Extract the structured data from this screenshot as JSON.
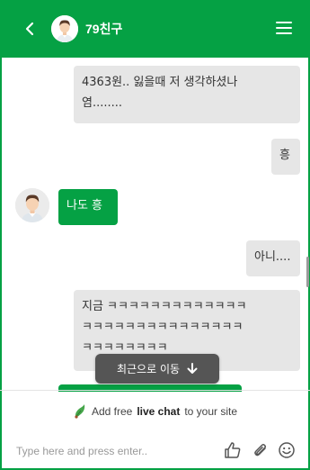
{
  "header": {
    "title": "79친구",
    "back_icon": "chevron-left-icon",
    "menu_icon": "hamburger-menu-icon",
    "color": "#05a144"
  },
  "messages": [
    {
      "side": "out",
      "lines": [
        "4363원.. 잃을때 저 생각하셨나",
        "염........"
      ]
    },
    {
      "side": "out",
      "lines": [
        "흥"
      ]
    },
    {
      "side": "in",
      "lines": [
        "나도 흥"
      ]
    },
    {
      "side": "out",
      "lines": [
        "아니...."
      ]
    },
    {
      "side": "out",
      "lines": [
        "지금 ㅋㅋㅋㅋㅋㅋㅋㅋㅋㅋㅋㅋㅋ",
        "ㅋㅋㅋㅋㅋㅋㅋㅋㅋㅋㅋㅋㅋㅋㅋ",
        "ㅋㅋㅋㅋㅋㅋㅋㅋ"
      ]
    }
  ],
  "jump_button": {
    "label": "최근으로 이동",
    "icon": "arrow-down-icon"
  },
  "branding": {
    "prefix": "Add free",
    "bold": "live chat",
    "suffix": "to your site"
  },
  "composer": {
    "placeholder": "Type here and press enter..",
    "icons": [
      "thumbs-up-icon",
      "paperclip-icon",
      "smiley-icon"
    ]
  }
}
